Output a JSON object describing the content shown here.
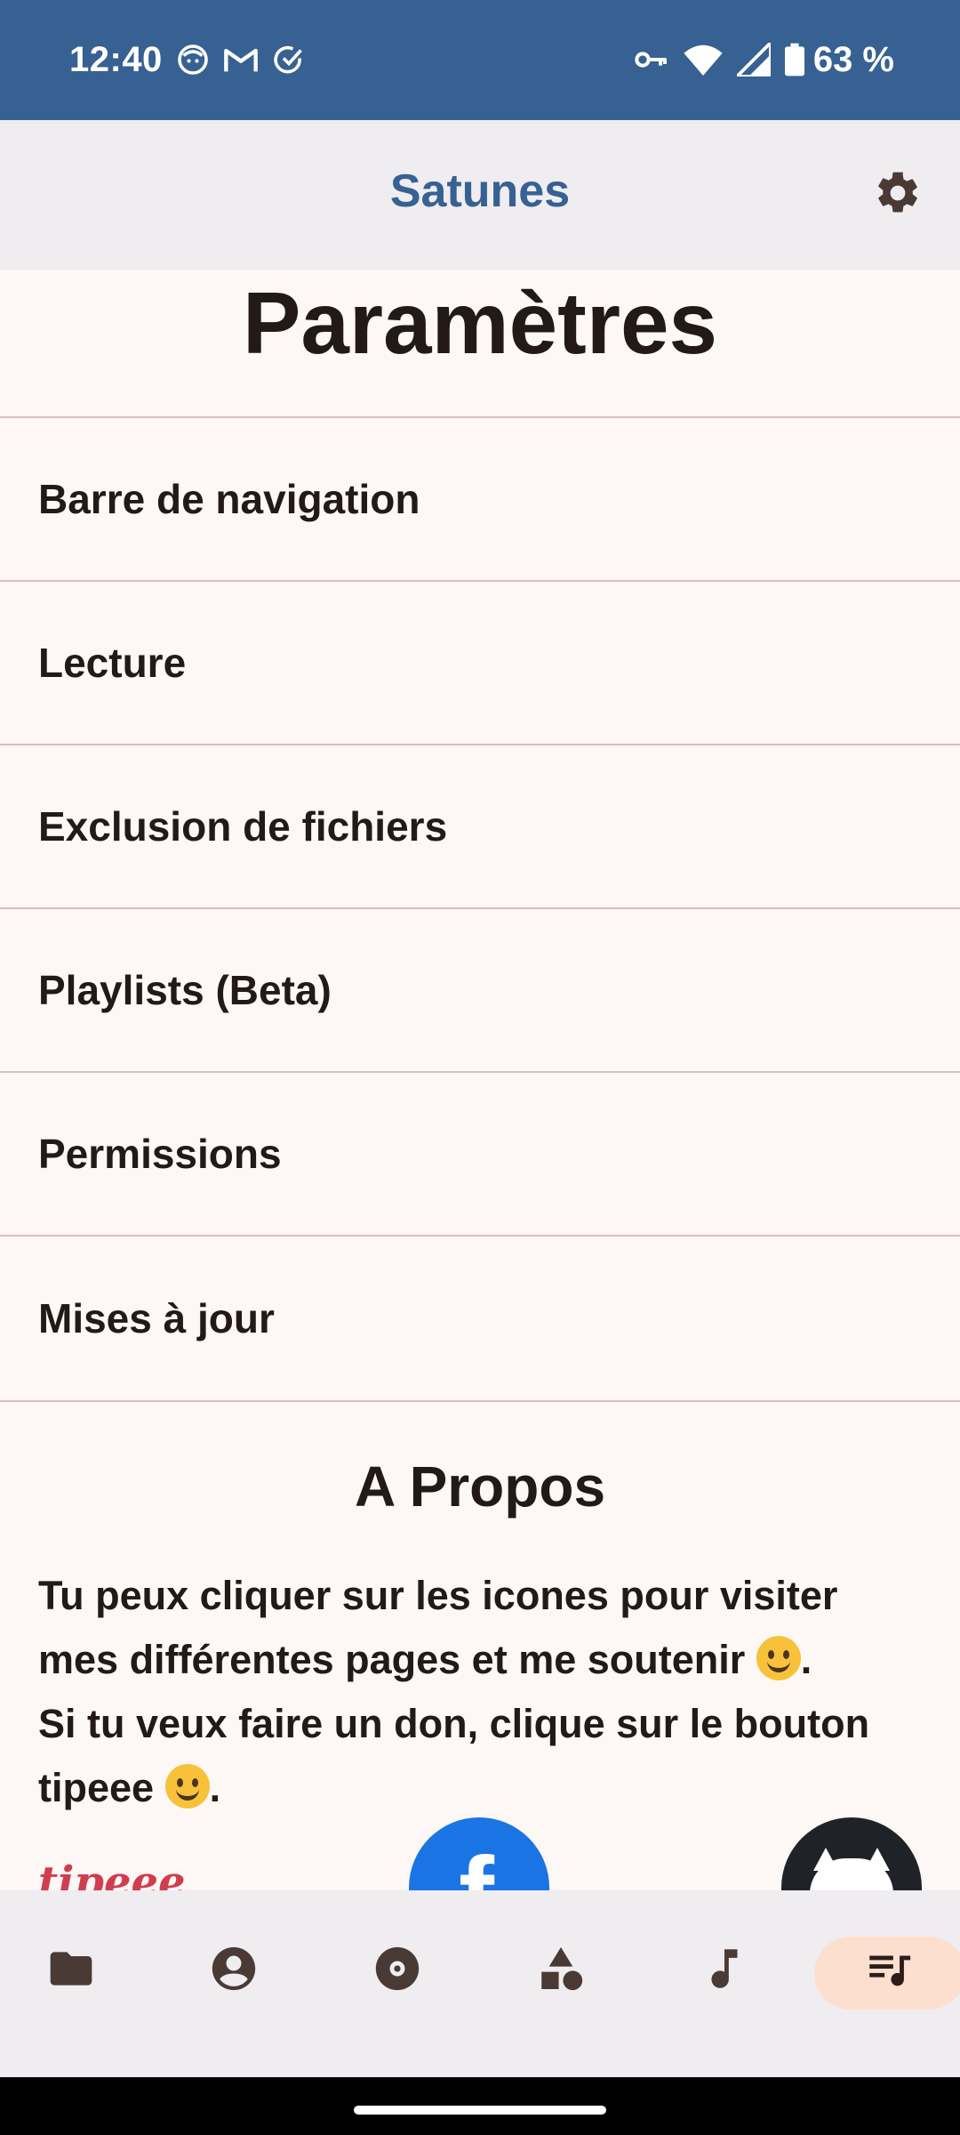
{
  "status_bar": {
    "time": "12:40",
    "battery_percent": "63 %",
    "left_icons": [
      "face-icon",
      "gmail-icon",
      "check-circle-icon"
    ],
    "right_icons": [
      "vpn-key-icon",
      "wifi-icon",
      "signal-icon",
      "battery-icon"
    ]
  },
  "app_bar": {
    "title": "Satunes",
    "settings_icon": "gear-icon"
  },
  "page": {
    "title": "Paramètres",
    "menu_items": [
      {
        "label": "Barre de navigation"
      },
      {
        "label": "Lecture"
      },
      {
        "label": "Exclusion de fichiers"
      },
      {
        "label": "Playlists (Beta)"
      },
      {
        "label": "Permissions"
      },
      {
        "label": "Mises à jour"
      }
    ],
    "about": {
      "title": "A Propos",
      "line1": "Tu peux cliquer sur les icones pour visiter",
      "line2": "mes différentes pages et me soutenir",
      "line3": "Si tu veux faire un don, clique sur le bouton",
      "line4": "tipeee",
      "links": {
        "tipeee": "tipeee",
        "facebook": "f"
      }
    }
  },
  "bottom_nav": {
    "items": [
      {
        "name": "folders",
        "icon": "folder-icon"
      },
      {
        "name": "artists",
        "icon": "person-icon"
      },
      {
        "name": "albums",
        "icon": "album-icon"
      },
      {
        "name": "genres",
        "icon": "shapes-icon"
      },
      {
        "name": "music",
        "icon": "music-note-icon"
      },
      {
        "name": "playlists",
        "icon": "queue-music-icon",
        "active": true
      }
    ]
  },
  "colors": {
    "status_bar": "#366192",
    "accent": "#366192",
    "background": "#fdf7f5",
    "divider": "#d9bfc2",
    "nav_background": "#efedf0",
    "nav_active": "#fcdfcf"
  }
}
